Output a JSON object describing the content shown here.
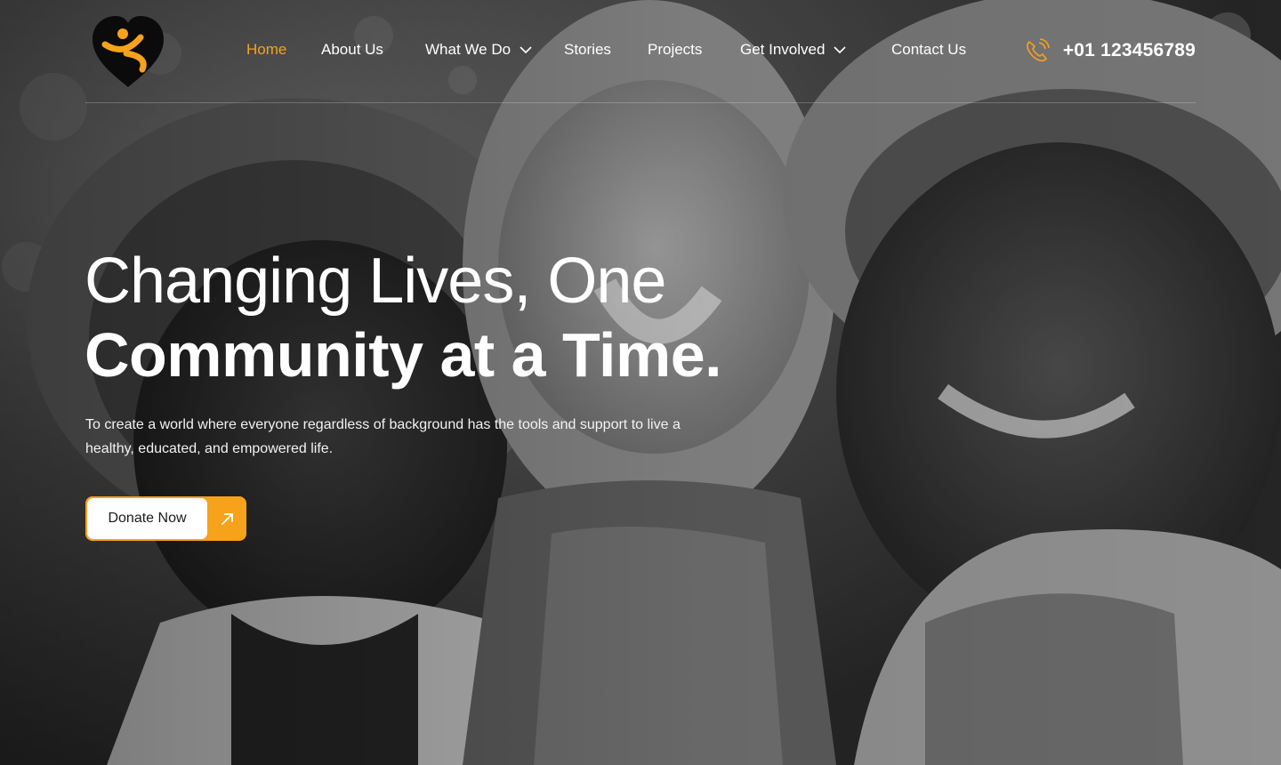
{
  "brand": {
    "accent_color": "#F7A21B",
    "logo_icon": "heart-person-logo-icon"
  },
  "nav": {
    "items": [
      {
        "label": "Home",
        "active": true,
        "has_dropdown": false
      },
      {
        "label": "About Us",
        "active": false,
        "has_dropdown": false
      },
      {
        "label": "What We Do",
        "active": false,
        "has_dropdown": true
      },
      {
        "label": "Stories",
        "active": false,
        "has_dropdown": false
      },
      {
        "label": "Projects",
        "active": false,
        "has_dropdown": false
      },
      {
        "label": "Get Involved",
        "active": false,
        "has_dropdown": true
      },
      {
        "label": "Contact Us",
        "active": false,
        "has_dropdown": false
      }
    ]
  },
  "phone": {
    "icon": "phone-ringing-icon",
    "number": "+01 123456789"
  },
  "hero": {
    "title_line1": "Changing Lives, One",
    "title_line2": "Community at a Time.",
    "description": "To create a world where everyone  regardless of background  has the tools and support to live a healthy, educated, and empowered life.",
    "cta_label": "Donate Now",
    "cta_icon": "arrow-up-right-icon"
  }
}
